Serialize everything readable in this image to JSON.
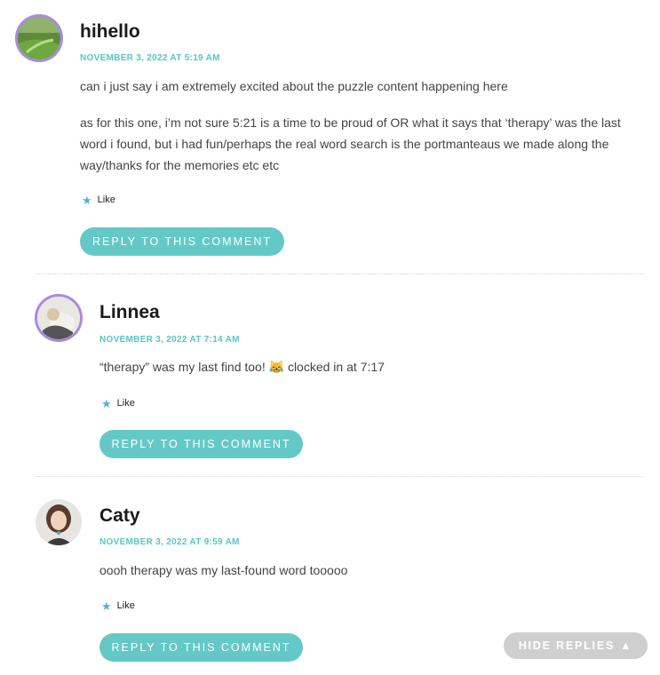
{
  "comments": [
    {
      "author": "hihello",
      "date": "NOVEMBER 3, 2022 AT 5:19 AM",
      "paragraphs": [
        "can i just say i am extremely excited about the puzzle content happening here",
        "as for this one, i’m not sure 5:21 is a time to be proud of OR what it says that ‘therapy’ was the last word i found, but i had fun/perhaps the real word search is the portmanteaus we made along the way/thanks for the memories etc etc"
      ],
      "like_label": "Like",
      "reply_label": "REPLY TO THIS COMMENT"
    },
    {
      "author": "Linnea",
      "date": "NOVEMBER 3, 2022 AT 7:14 AM",
      "paragraphs": [
        "“therapy” was my last find too! 😹 clocked in at 7:17"
      ],
      "like_label": "Like",
      "reply_label": "REPLY TO THIS COMMENT"
    },
    {
      "author": "Caty",
      "date": "NOVEMBER 3, 2022 AT 9:59 AM",
      "paragraphs": [
        "oooh therapy was my last-found word tooooo"
      ],
      "like_label": "Like",
      "reply_label": "REPLY TO THIS COMMENT"
    }
  ],
  "hide_replies_label": "HIDE REPLIES",
  "icons": {
    "like": "star-icon",
    "hide_replies": "triangle-up-icon"
  },
  "colors": {
    "accent": "#64c9c6",
    "date": "#57c6c3",
    "avatar_ring": "#a88bdb",
    "hide_button": "#cfcfcf"
  }
}
